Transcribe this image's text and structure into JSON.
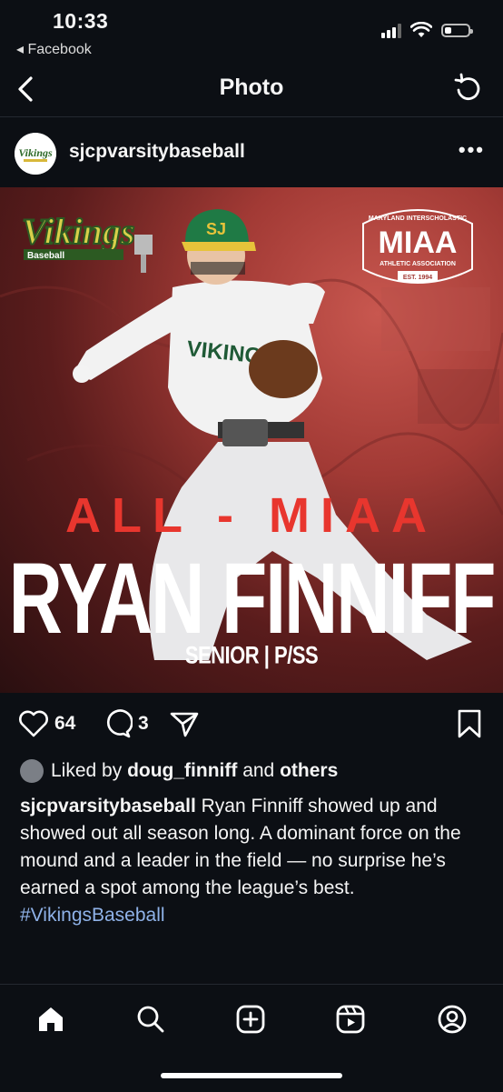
{
  "status": {
    "time": "10:33",
    "back_app": "◂ Facebook",
    "battery_level": 0.3
  },
  "nav": {
    "title": "Photo"
  },
  "post": {
    "username": "sjcpvarsitybaseball",
    "more_label": "•••",
    "photo": {
      "logo_text": "Vikings",
      "logo_sub": "Baseball",
      "badge_top": "MARYLAND INTERSCHOLASTIC",
      "badge_main": "MIAA",
      "badge_sub": "ATHLETIC ASSOCIATION",
      "badge_est": "EST. 1994",
      "jersey_text": "VIKINGS",
      "cap_letter": "SJ",
      "headline": "ALL - MIAA",
      "player_name": "RYAN FINNIFF",
      "position": "SENIOR | P/SS"
    },
    "likes_count": "64",
    "comments_count": "3",
    "liked_by_prefix": "Liked by",
    "liked_by_user": "doug_finniff",
    "liked_by_and": "and",
    "liked_by_others": "others",
    "caption_user": "sjcpvarsitybaseball",
    "caption_text": "Ryan Finniff showed up and showed out all season long. A dominant force on the mound and a leader in the field — no surprise he’s earned a spot among the league’s best.",
    "hashtag": "#VikingsBaseball"
  },
  "colors": {
    "background": "#0c0f14",
    "hashtag": "#8fb2e8",
    "headline_red": "#e8362e",
    "cap_green": "#1f7a45"
  },
  "tabs": [
    "home-icon",
    "search-icon",
    "create-icon",
    "reels-icon",
    "profile-icon"
  ]
}
